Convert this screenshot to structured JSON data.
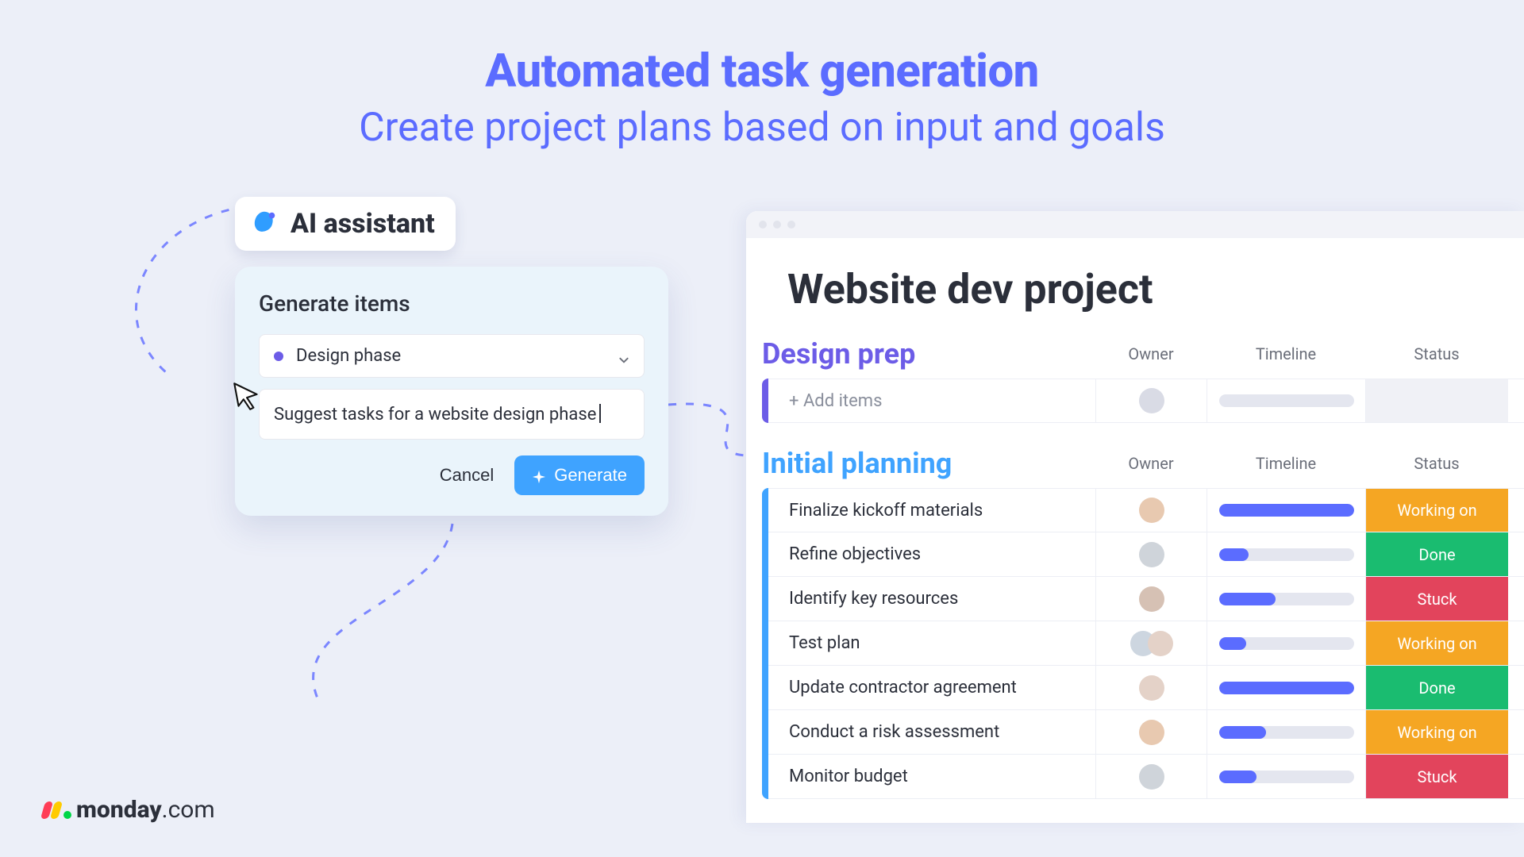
{
  "headline": {
    "title": "Automated task generation",
    "subtitle": "Create project plans based on input and goals"
  },
  "ai_assistant": {
    "badge_label": "AI assistant",
    "panel_title": "Generate items",
    "dropdown_value": "Design phase",
    "prompt_text": "Suggest tasks for a website design phase",
    "cancel_label": "Cancel",
    "generate_label": "Generate"
  },
  "board": {
    "title": "Website dev project",
    "columns": {
      "owner": "Owner",
      "timeline": "Timeline",
      "status": "Status"
    },
    "groups": [
      {
        "id": "design-prep",
        "name": "Design prep",
        "color": "#6c5ce7",
        "rows": [
          {
            "name": "+ Add items",
            "add": true,
            "timeline_pct": 0,
            "status": "empty",
            "status_label": ""
          }
        ]
      },
      {
        "id": "initial-planning",
        "name": "Initial planning",
        "color": "#3fa3ff",
        "rows": [
          {
            "name": "Finalize kickoff materials",
            "timeline_pct": 100,
            "status": "working",
            "status_label": "Working on"
          },
          {
            "name": "Refine objectives",
            "timeline_pct": 22,
            "status": "done",
            "status_label": "Done"
          },
          {
            "name": "Identify key resources",
            "timeline_pct": 42,
            "status": "stuck",
            "status_label": "Stuck"
          },
          {
            "name": "Test plan",
            "timeline_pct": 20,
            "status": "working",
            "status_label": "Working on",
            "two_owners": true
          },
          {
            "name": "Update contractor agreement",
            "timeline_pct": 100,
            "status": "done",
            "status_label": "Done"
          },
          {
            "name": "Conduct a risk assessment",
            "timeline_pct": 35,
            "status": "working",
            "status_label": "Working on"
          },
          {
            "name": "Monitor budget",
            "timeline_pct": 28,
            "status": "stuck",
            "status_label": "Stuck"
          }
        ]
      }
    ]
  },
  "brand": {
    "name": "monday",
    "suffix": ".com"
  }
}
